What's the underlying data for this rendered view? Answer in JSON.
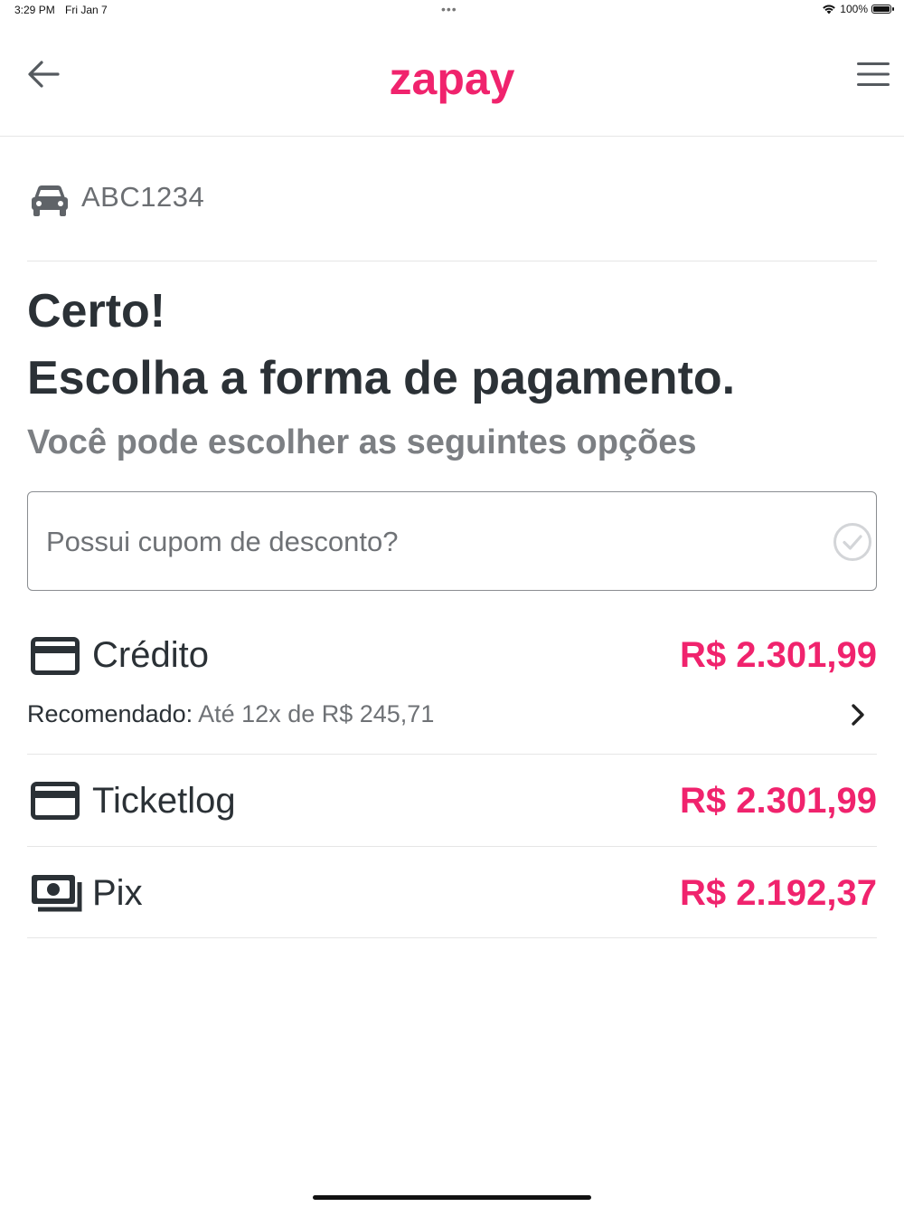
{
  "status_bar": {
    "time": "3:29 PM",
    "date": "Fri Jan 7",
    "dots": "•••",
    "battery_percent": "100%",
    "battery_level": 1.0
  },
  "header": {
    "logo": "zapay",
    "back_icon": "arrow-left-icon",
    "menu_icon": "hamburger-menu-icon"
  },
  "vehicle": {
    "icon": "car-icon",
    "plate": "ABC1234"
  },
  "titles": {
    "line1": "Certo!",
    "line2": "Escolha a forma de pagamento.",
    "subtitle": "Você pode escolher as seguintes opções"
  },
  "coupon": {
    "value": "",
    "placeholder": "Possui cupom de desconto?",
    "check_icon": "check-circle-icon"
  },
  "payment_options": [
    {
      "icon": "credit-card-icon",
      "label": "Crédito",
      "price": "R$ 2.301,99",
      "recommend_label": "Recomendado:",
      "recommend_value": "Até 12x de R$ 245,71",
      "chevron_icon": "chevron-right-icon"
    },
    {
      "icon": "credit-card-icon",
      "label": "Ticketlog",
      "price": "R$ 2.301,99"
    },
    {
      "icon": "cash-icon",
      "label": "Pix",
      "price": "R$ 2.192,37"
    }
  ],
  "colors": {
    "brand": "#f0236d",
    "text_dark": "#2b3136",
    "text_muted": "#7c7f83"
  }
}
